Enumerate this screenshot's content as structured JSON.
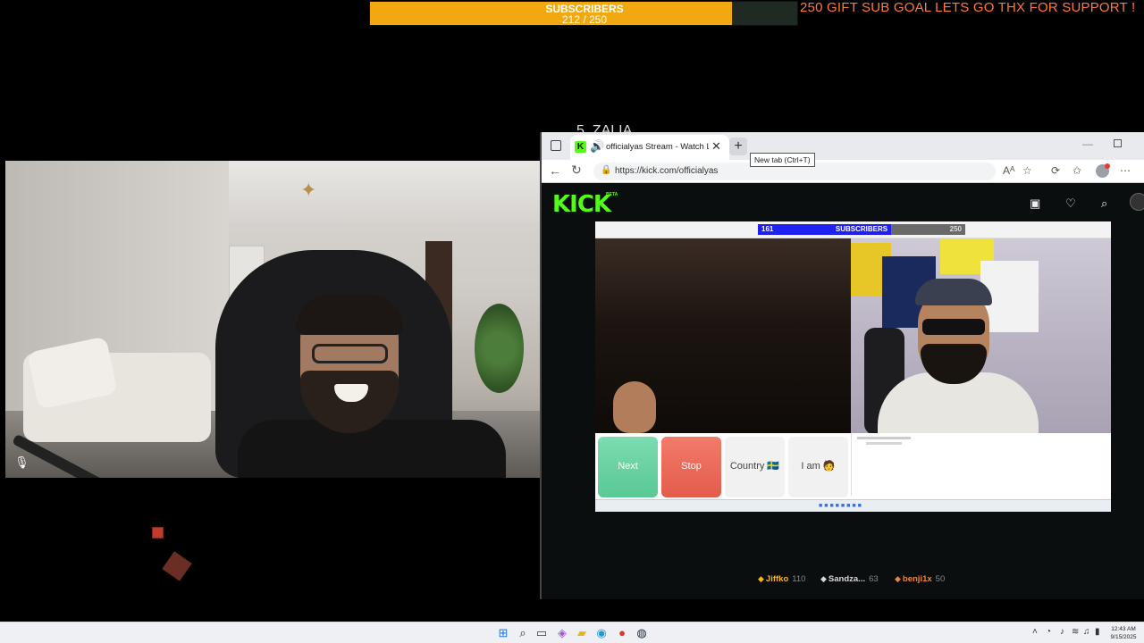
{
  "overlay": {
    "subscribers_title": "SUBSCRIBERS",
    "subscribers_count": "212 / 250",
    "subscribers_progress": 0.848,
    "goal_text": "250 GIFT SUB GOAL LETS GO THX FOR SUPPORT !",
    "partial_text": "5. ZALIA",
    "accent_color": "#f2a90f"
  },
  "browser": {
    "tab": {
      "title": "officialyas Stream - Watch Li",
      "favicon": "K",
      "speaker_icon": "speaker-icon",
      "close_icon": "close-icon"
    },
    "new_tab_tooltip": "New tab (Ctrl+T)",
    "url": "https://kick.com/officialyas",
    "icons": [
      "back-icon",
      "reload-icon",
      "lock-icon",
      "read-aloud-icon",
      "favorite-icon",
      "extensions-icon",
      "favorites-list-icon",
      "profile-icon",
      "more-icon"
    ]
  },
  "kick": {
    "logo": "KICK",
    "beta": "BETA",
    "brand_color": "#53fc18",
    "header_icons": [
      "browse-icon",
      "following-icon",
      "search-icon",
      "user-avatar"
    ],
    "player": {
      "sub_current": "161",
      "sub_title": "SUBSCRIBERS",
      "sub_max": "250",
      "sub_progress": 0.644,
      "buttons": {
        "next": "Next",
        "stop": "Stop",
        "country": "Country 🇸🇪",
        "iam": "I am 🧑"
      }
    },
    "leaderboard": [
      {
        "name": "Jiffko",
        "count": "110",
        "color": "#f5b41a"
      },
      {
        "name": "Sandza...",
        "count": "63",
        "color": "#d9d9d9"
      },
      {
        "name": "benji1x",
        "count": "50",
        "color": "#e9873a"
      }
    ]
  },
  "taskbar": {
    "clock_time": "12:43 AM",
    "clock_date": "9/15/2025",
    "apps": [
      "windows-start-icon",
      "search-icon",
      "task-view-icon",
      "copilot-icon",
      "file-explorer-icon",
      "edge-icon",
      "app-icon",
      "steam-icon"
    ]
  }
}
